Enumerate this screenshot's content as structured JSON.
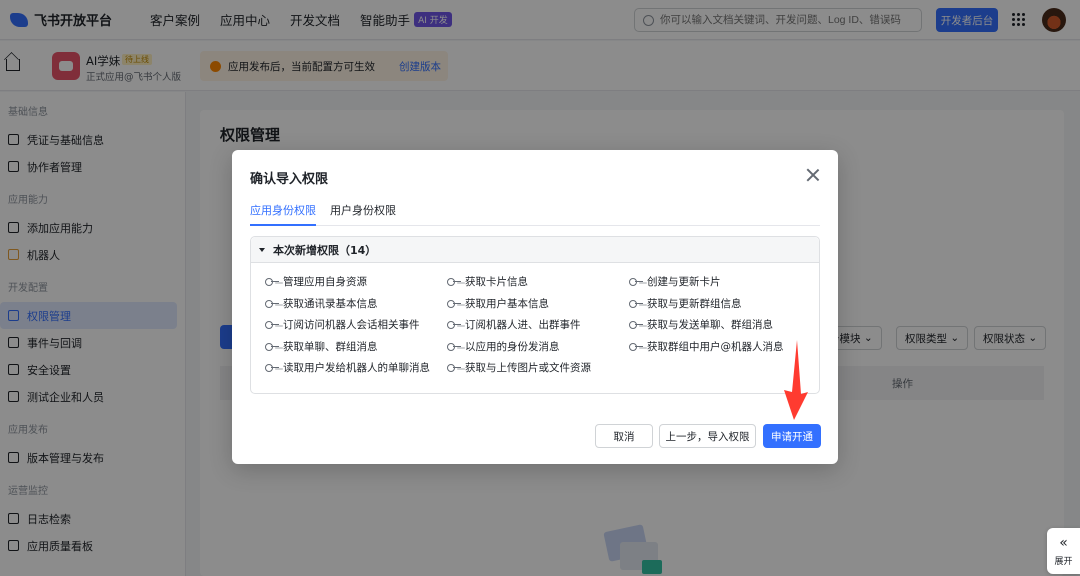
{
  "topbar": {
    "logo_text": "飞书开放平台",
    "nav": [
      "客户案例",
      "应用中心",
      "开发文档",
      "智能助手"
    ],
    "ai_badge": "AI 开发",
    "search_placeholder": "你可以输入文档关键词、开发问题、Log ID、错误码",
    "dev_console": "开发者后台"
  },
  "appbar": {
    "app_name": "AI学妹",
    "app_tag": "待上线",
    "app_sub": "正式应用@飞书个人版",
    "notice": "应用发布后，当前配置方可生效",
    "notice_link": "创建版本"
  },
  "sidebar": {
    "groups": [
      {
        "title": "基础信息",
        "items": [
          "凭证与基础信息",
          "协作者管理"
        ]
      },
      {
        "title": "应用能力",
        "items": [
          "添加应用能力",
          "机器人"
        ]
      },
      {
        "title": "开发配置",
        "items": [
          "权限管理",
          "事件与回调",
          "安全设置",
          "测试企业和人员"
        ]
      },
      {
        "title": "应用发布",
        "items": [
          "版本管理与发布"
        ]
      },
      {
        "title": "运营监控",
        "items": [
          "日志检索",
          "应用质量看板"
        ]
      }
    ]
  },
  "main": {
    "title": "权限管理",
    "filters": [
      "务模块",
      "权限类型",
      "权限状态"
    ],
    "table_op": "操作"
  },
  "dialog": {
    "title": "确认导入权限",
    "tabs": [
      "应用身份权限",
      "用户身份权限"
    ],
    "section_title": "本次新增权限（14）",
    "permissions": [
      "管理应用自身资源",
      "获取卡片信息",
      "创建与更新卡片",
      "获取通讯录基本信息",
      "获取用户基本信息",
      "获取与更新群组信息",
      "订阅访问机器人会话相关事件",
      "订阅机器人进、出群事件",
      "获取与发送单聊、群组消息",
      "获取单聊、群组消息",
      "以应用的身份发消息",
      "获取群组中用户@机器人消息",
      "读取用户发给机器人的单聊消息",
      "获取与上传图片或文件资源"
    ],
    "buttons": {
      "cancel": "取消",
      "back": "上一步，导入权限",
      "apply": "申请开通"
    }
  },
  "expand_label": "展开",
  "colors": {
    "primary": "#3370ff",
    "arrow": "#ff3b30"
  }
}
